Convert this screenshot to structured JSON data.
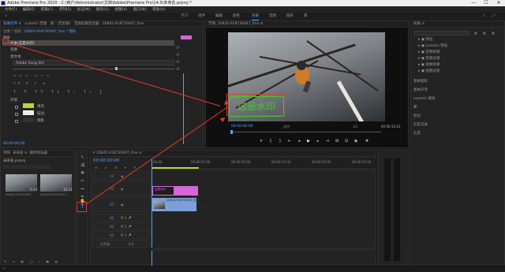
{
  "window": {
    "title": "Adobe Premiere Pro 2020 - C:\\用户\\Administrator\\文档\\Adobe\\Premiere Pro\\14.0\\未命名.prproj *",
    "minimize": "—",
    "maximize": "☐",
    "close": "✕"
  },
  "menu": [
    "文件(F)",
    "编辑(E)",
    "剪辑(C)",
    "序列(S)",
    "标记(M)",
    "图形(G)",
    "视图(V)",
    "窗口(W)",
    "帮助(H)"
  ],
  "workspaces": [
    "学习",
    "组件",
    "编辑",
    "颜色",
    "效果",
    "音频",
    "图形",
    "库"
  ],
  "workspace_active": "效果",
  "effect_controls": {
    "tabs": [
      "效果控件 ≡",
      "Lumetri 范围",
      "源：(无剪辑)",
      "音频剪辑混合器：20845-918730047_fine"
    ],
    "source_line": "主要 * 图形",
    "clip_line": "20845-918730047_fine * 图形",
    "section": "图形",
    "items": [
      "文本(这是水印)",
      "变换",
      "源文本",
      "Adobe Song Std"
    ],
    "appearance_label": "外观",
    "fill_label": "填充",
    "stroke_label": "描边",
    "shadow_label": "阴影",
    "timecode": "00:00:00:00",
    "fill_color": "#b8d82a"
  },
  "program_monitor": {
    "title": "节目: 20845-918730047_fine ≡",
    "timecode": "00:00:00:00",
    "fit": "适合",
    "quality": "1/2",
    "duration": "00:00:10:23",
    "watermark_text": "这是水印",
    "watermark_color": "#3fcc2a"
  },
  "project": {
    "tabs": [
      "项目: 未命名 ≡",
      "媒体浏览器"
    ],
    "file": "未命名.prproj",
    "items": [
      "20845-918730047...",
      "20845-918730047..."
    ],
    "durations": [
      "5:23",
      "10:23"
    ]
  },
  "timeline": {
    "title": "20845-918730047_fine ≡",
    "timecode": "00:00:00:00",
    "ruler": [
      "00:00",
      "00:00:05:00",
      "00:00:10:00",
      "00:00:15:00",
      "00:00:20:00",
      "00:00:25:00"
    ],
    "tracks_v": [
      "V3",
      "V2",
      "V1"
    ],
    "tracks_a": [
      "A1",
      "A2",
      "A3"
    ],
    "master_label": "主声道",
    "master_value": "0.0",
    "clip_v2": "这是水印",
    "clip_v1": "20845-918730047_fine.mp4 [V]"
  },
  "effects_panel": {
    "title": "效果 ≡",
    "items": [
      "预设",
      "Lumetri 预设",
      "音频效果",
      "音频过渡",
      "视频效果",
      "视频过渡"
    ],
    "sections": [
      "基本图形",
      "基本声音",
      "Lumetri 颜色",
      "库",
      "标记",
      "历史记录",
      "信息"
    ]
  },
  "annotations": {
    "color": "#e03a2a"
  }
}
